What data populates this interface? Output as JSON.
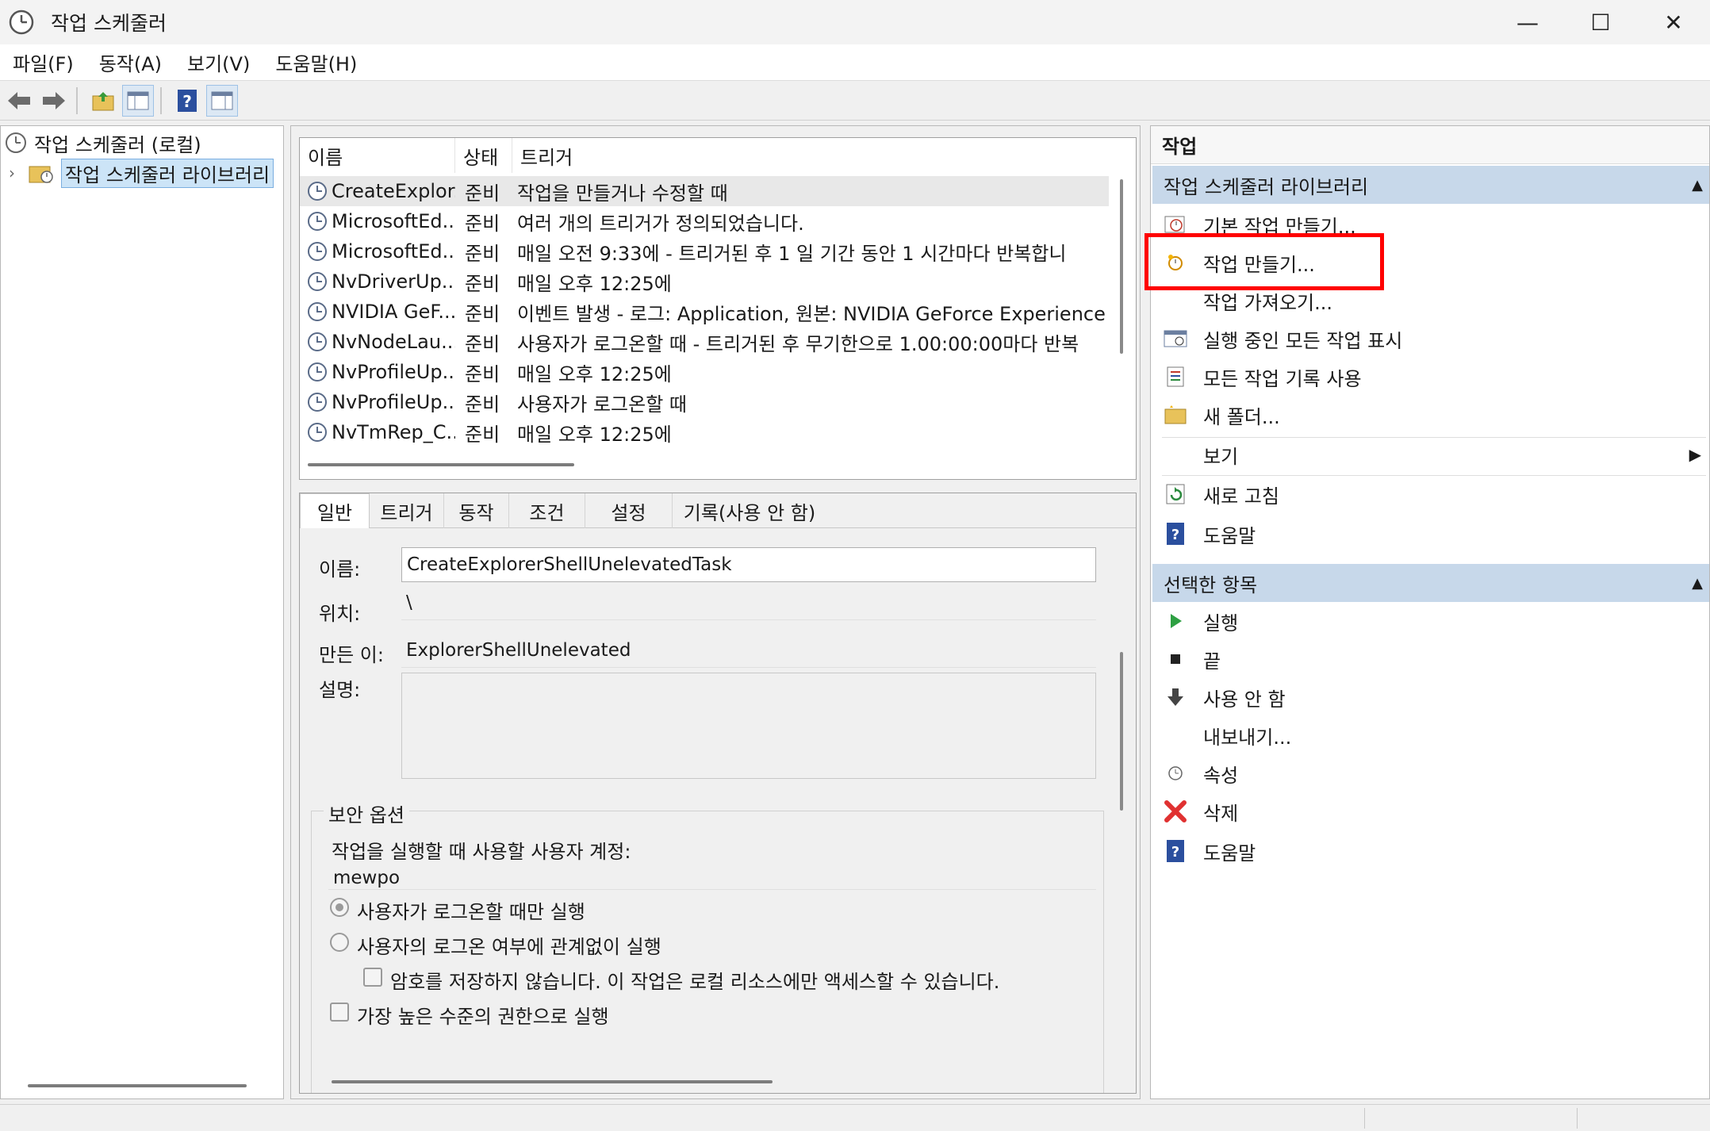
{
  "window": {
    "title": "작업 스케줄러",
    "min": "—",
    "max": "☐",
    "close": "✕"
  },
  "menu": [
    "파일(F)",
    "동작(A)",
    "보기(V)",
    "도움말(H)"
  ],
  "tree": {
    "root": "작업 스케줄러 (로컬)",
    "library": "작업 스케줄러 라이브러리"
  },
  "tasks": {
    "headers": [
      "이름",
      "상태",
      "트리거"
    ],
    "rows": [
      {
        "name": "CreateExplor...",
        "status": "준비",
        "trigger": "작업을 만들거나 수정할 때"
      },
      {
        "name": "MicrosoftEd...",
        "status": "준비",
        "trigger": "여러 개의 트리거가 정의되었습니다."
      },
      {
        "name": "MicrosoftEd...",
        "status": "준비",
        "trigger": "매일 오전 9:33에 - 트리거된 후 1 일 기간 동안 1 시간마다 반복합니"
      },
      {
        "name": "NvDriverUp...",
        "status": "준비",
        "trigger": "매일 오후 12:25에"
      },
      {
        "name": "NVIDIA GeF...",
        "status": "준비",
        "trigger": "이벤트 발생 - 로그: Application, 원본: NVIDIA GeForce Experience S"
      },
      {
        "name": "NvNodeLau...",
        "status": "준비",
        "trigger": "사용자가 로그온할 때 - 트리거된 후 무기한으로 1.00:00:00마다 반복"
      },
      {
        "name": "NvProfileUp...",
        "status": "준비",
        "trigger": "매일 오후 12:25에"
      },
      {
        "name": "NvProfileUp...",
        "status": "준비",
        "trigger": "사용자가 로그온할 때"
      },
      {
        "name": "NvTmRep_C...",
        "status": "준비",
        "trigger": "매일 오후 12:25에"
      }
    ]
  },
  "detail": {
    "tabs": [
      "일반",
      "트리거",
      "동작",
      "조건",
      "설정",
      "기록(사용 안 함)"
    ],
    "name_label": "이름:",
    "name_value": "CreateExplorerShellUnelevatedTask",
    "location_label": "위치:",
    "location_value": "\\",
    "author_label": "만든 이:",
    "author_value": "ExplorerShellUnelevated",
    "desc_label": "설명:",
    "security_title": "보안 옵션",
    "account_label": "작업을 실행할 때 사용할 사용자 계정:",
    "account_value": "mewpo",
    "opt1": "사용자가 로그온할 때만 실행",
    "opt2": "사용자의 로그온 여부에 관계없이 실행",
    "opt3": "암호를 저장하지 않습니다. 이 작업은 로컬 리소스에만 액세스할 수 있습니다.",
    "opt4": "가장 높은 수준의 권한으로 실행"
  },
  "actions": {
    "header": "작업",
    "section1": "작업 스케줄러 라이브러리",
    "items1": [
      "기본 작업 만들기...",
      "작업 만들기...",
      "작업 가져오기...",
      "실행 중인 모든 작업 표시",
      "모든 작업 기록 사용",
      "새 폴더...",
      "보기",
      "새로 고침",
      "도움말"
    ],
    "section2": "선택한 항목",
    "items2": [
      "실행",
      "끝",
      "사용 안 함",
      "내보내기...",
      "속성",
      "삭제",
      "도움말"
    ]
  }
}
